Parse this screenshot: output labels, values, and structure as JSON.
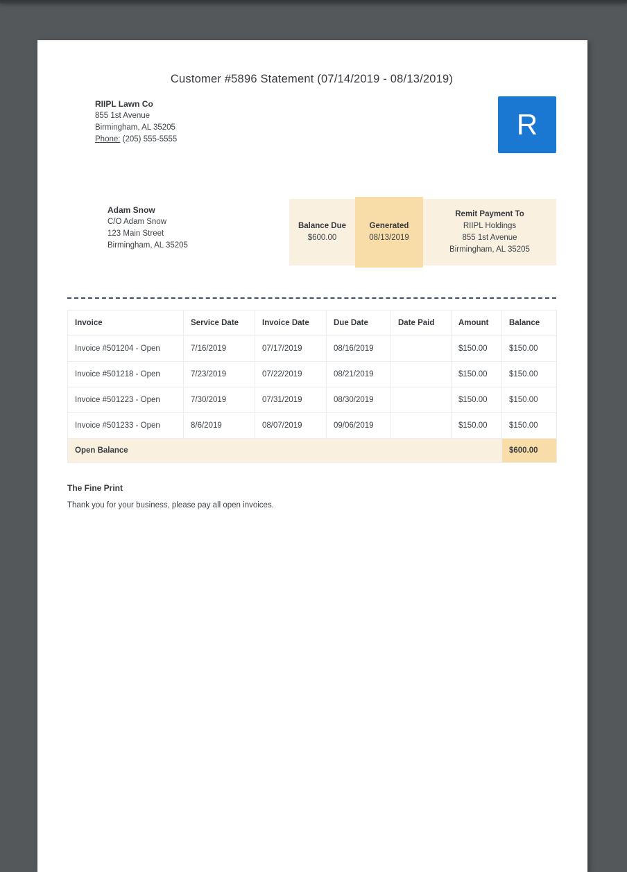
{
  "doc": {
    "title": "Customer #5896 Statement (07/14/2019 - 08/13/2019)"
  },
  "company": {
    "name": "RIIPL Lawn Co",
    "address_line1": "855 1st Avenue",
    "address_line2": "Birmingham, AL 35205",
    "phone_label": "Phone:",
    "phone_value": "(205) 555-5555",
    "logo_letter": "R",
    "logo_color": "#1b78d2"
  },
  "customer": {
    "name": "Adam Snow",
    "care_of": "C/O Adam Snow",
    "address_line1": "123 Main Street",
    "address_line2": "Birmingham, AL 35205"
  },
  "summary": {
    "light_bg": "#faf0e0",
    "dark_bg": "#f8dda9",
    "balance_due_label": "Balance Due",
    "balance_due_value": "$600.00",
    "generated_label": "Generated",
    "generated_value": "08/13/2019",
    "remit_label": "Remit Payment To",
    "remit_name": "RIIPL Holdings",
    "remit_address1": "855 1st Avenue",
    "remit_address2": "Birmingham, AL 35205"
  },
  "invoice_table": {
    "columns": [
      "Invoice",
      "Service Date",
      "Invoice Date",
      "Due Date",
      "Date Paid",
      "Amount",
      "Balance"
    ],
    "rows": [
      {
        "invoice": "Invoice #501204 - Open",
        "service_date": "7/16/2019",
        "invoice_date": "07/17/2019",
        "due_date": "08/16/2019",
        "date_paid": "",
        "amount": "$150.00",
        "balance": "$150.00"
      },
      {
        "invoice": "Invoice #501218 - Open",
        "service_date": "7/23/2019",
        "invoice_date": "07/22/2019",
        "due_date": "08/21/2019",
        "date_paid": "",
        "amount": "$150.00",
        "balance": "$150.00"
      },
      {
        "invoice": "Invoice #501223 - Open",
        "service_date": "7/30/2019",
        "invoice_date": "07/31/2019",
        "due_date": "08/30/2019",
        "date_paid": "",
        "amount": "$150.00",
        "balance": "$150.00"
      },
      {
        "invoice": "Invoice #501233 - Open",
        "service_date": "8/6/2019",
        "invoice_date": "08/07/2019",
        "due_date": "09/06/2019",
        "date_paid": "",
        "amount": "$150.00",
        "balance": "$150.00"
      }
    ],
    "footer": {
      "label": "Open Balance",
      "value": "$600.00"
    }
  },
  "fine_print": {
    "heading": "The Fine Print",
    "text": "Thank you for your business, please pay all open invoices."
  }
}
